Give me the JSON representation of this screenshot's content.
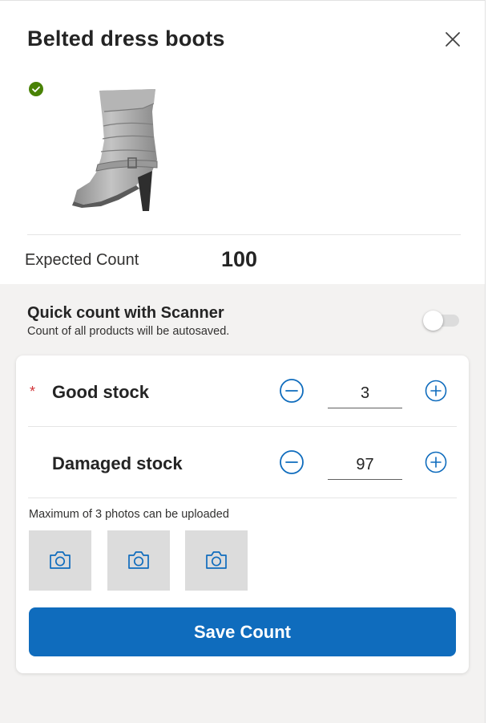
{
  "product": {
    "name": "Belted dress boots",
    "image_icon": "boot-product-image",
    "status_icon": "check-circle-icon"
  },
  "expected": {
    "label": "Expected Count",
    "value": "100"
  },
  "quick_count": {
    "title": "Quick count with Scanner",
    "subtitle": "Count of all products will be autosaved.",
    "enabled": false
  },
  "stock_rows": [
    {
      "required_mark": "*",
      "label": "Good stock",
      "value": "3"
    },
    {
      "required_mark": "",
      "label": "Damaged stock",
      "value": "97"
    }
  ],
  "photos": {
    "note": "Maximum of 3 photos can be uploaded",
    "slot_icon": "camera-icon"
  },
  "actions": {
    "save_label": "Save Count"
  },
  "colors": {
    "accent": "#0f6cbd",
    "success": "#498205",
    "required": "#d13438",
    "panel_bg": "#f3f2f1"
  }
}
